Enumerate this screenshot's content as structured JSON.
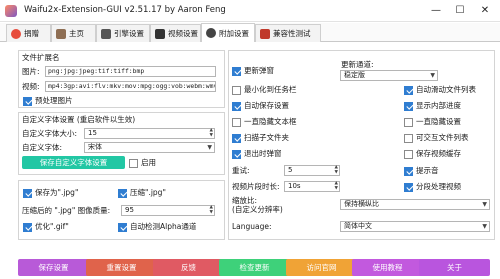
{
  "window": {
    "title": "Waifu2x-Extension-GUI v2.51.17 by Aaron Feng"
  },
  "tabs": [
    {
      "label": "捐赠",
      "icon": "heart-icon",
      "color": "#e74c3c"
    },
    {
      "label": "主页",
      "icon": "home-icon",
      "color": "#8e6e53"
    },
    {
      "label": "引擎设置",
      "icon": "engine-icon",
      "color": "#555555"
    },
    {
      "label": "视频设置",
      "icon": "video-icon",
      "color": "#333333"
    },
    {
      "label": "附加设置",
      "icon": "settings-icon",
      "color": "#444444"
    },
    {
      "label": "兼容性测试",
      "icon": "test-icon",
      "color": "#c0392b"
    }
  ],
  "file_ext": {
    "title": "文件扩展名",
    "image_label": "图片:",
    "image_value": "png:jpg:jpeg:tif:tiff:bmp",
    "video_label": "视频:",
    "video_value": "mp4:3gp:avi:flv:mkv:mov:mpg:ogg:vob:webm:wmv",
    "predecode_label": "预处理图片",
    "predecode_checked": true
  },
  "custom_font": {
    "title": "自定义字体设置 (重启软件以生效)",
    "size_label": "自定义字体大小:",
    "size_value": "15",
    "font_label": "自定义字体:",
    "font_value": "宋体",
    "save_button": "保存自定义字体设置",
    "enable_label": "启用",
    "enable_checked": false
  },
  "image_opts": {
    "save_jpg_label": "保存为\".jpg\"",
    "save_jpg_checked": true,
    "compress_label": "压缩\".jpg\"",
    "compress_checked": true,
    "quality_label": "压缩后的 \".jpg\" 图像质量:",
    "quality_value": "95",
    "opt_gif_label": "优化\".gif\"",
    "opt_gif_checked": true,
    "alpha_label": "自动检测Alpha通道",
    "alpha_checked": true
  },
  "right_panel": {
    "update_check_label": "更新弹窗",
    "update_check_checked": true,
    "update_channel_label": "更新通道:",
    "update_channel_value": "稳定版",
    "minimize_label": "最小化到任务栏",
    "minimize_checked": false,
    "auto_scroll_label": "自动滑动文件列表",
    "auto_scroll_checked": true,
    "autosave_label": "自动保存设置",
    "autosave_checked": true,
    "show_progress_label": "显示内部进度",
    "show_progress_checked": true,
    "hide_textbox_label": "一直隐藏文本框",
    "hide_textbox_checked": false,
    "hide_settings_label": "一直隐藏设置",
    "hide_settings_checked": false,
    "scan_subfolder_label": "扫描子文件夹",
    "scan_subfolder_checked": true,
    "export_list_label": "可交互文件列表",
    "export_list_checked": false,
    "exit_popup_label": "退出时弹窗",
    "exit_popup_checked": true,
    "save_video_cache_label": "保存视频缓存",
    "save_video_cache_checked": false,
    "retry_label": "重试:",
    "retry_value": "5",
    "notify_label": "提示音",
    "notify_checked": true,
    "segment_label": "视频片段时长:",
    "segment_value": "10s",
    "segment_proc_label": "分段处理视频",
    "segment_proc_checked": true,
    "scale_label_line1": "缩放比:",
    "scale_label_line2": "(自定义分辨率)",
    "scale_value": "保持横纵比",
    "language_label": "Language:",
    "language_value": "简体中文"
  },
  "bottom_buttons": [
    {
      "label": "保存设置",
      "color": "#b85ad8",
      "name": "save-settings-button"
    },
    {
      "label": "重置设置",
      "color": "#e0634b",
      "name": "reset-settings-button"
    },
    {
      "label": "反馈",
      "color": "#e05a63",
      "name": "feedback-button"
    },
    {
      "label": "检查更新",
      "color": "#3ed17a",
      "name": "check-update-button"
    },
    {
      "label": "访问官网",
      "color": "#f0a336",
      "name": "visit-website-button"
    },
    {
      "label": "使用教程",
      "color": "#c259de",
      "name": "tutorial-button"
    },
    {
      "label": "关于",
      "color": "#b955de",
      "name": "about-button"
    }
  ]
}
